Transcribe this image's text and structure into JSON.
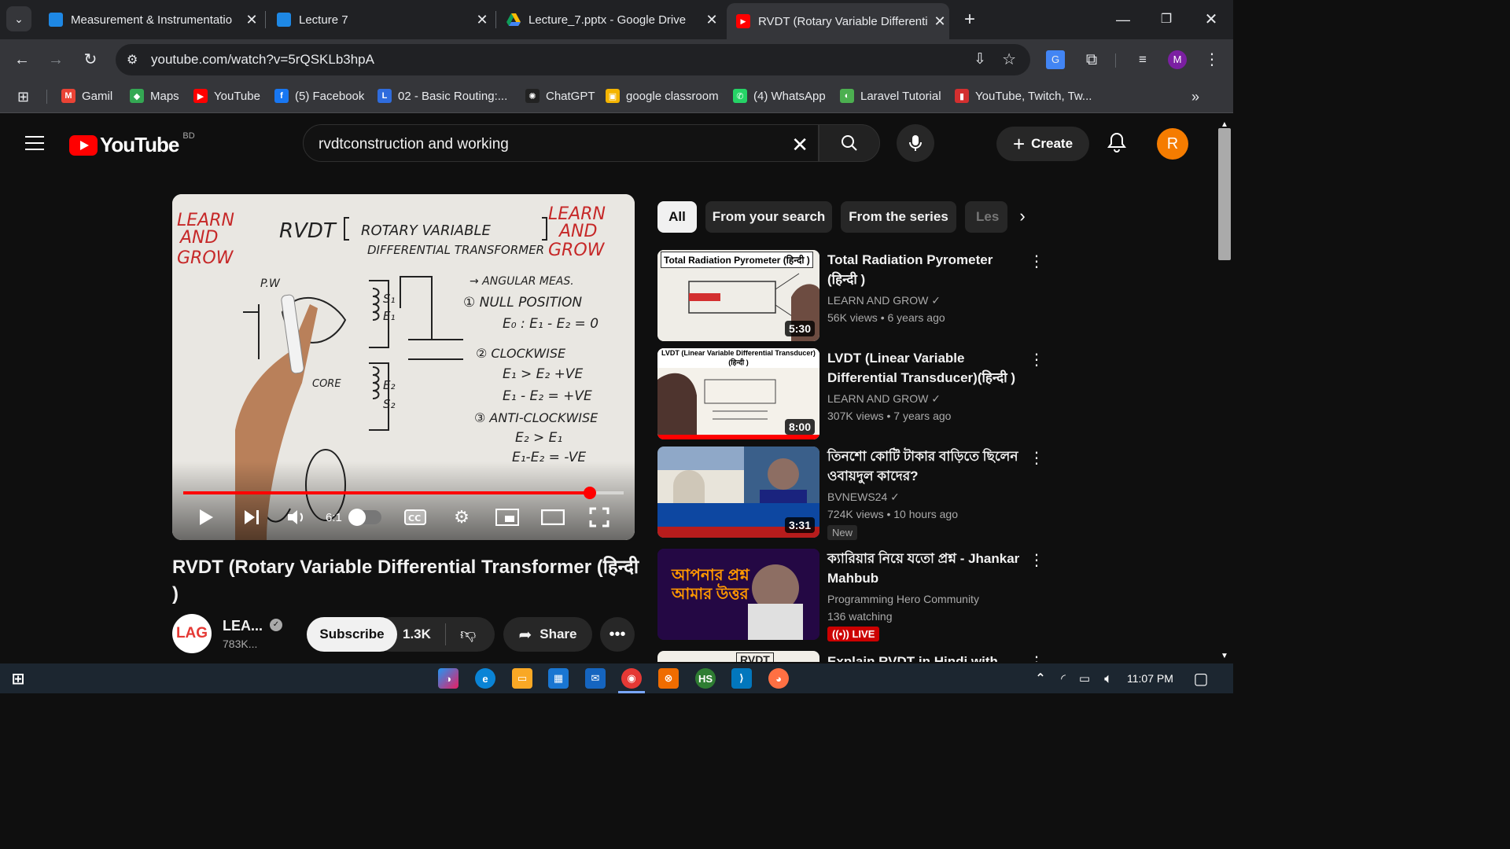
{
  "browser": {
    "tabs": [
      {
        "title": "Measurement & Instrumentatio",
        "icon": "classroom-icon"
      },
      {
        "title": "Lecture 7",
        "icon": "classroom-icon"
      },
      {
        "title": "Lecture_7.pptx - Google Drive",
        "icon": "drive-icon"
      },
      {
        "title": "RVDT (Rotary Variable Differenti",
        "icon": "youtube-icon",
        "active": true
      }
    ],
    "url": "youtube.com/watch?v=5rQSKLb3hpA",
    "profile_initial": "M",
    "bookmarks": [
      {
        "label": "Gamil",
        "icon": "gmail-icon",
        "color": "#ea4335",
        "glyph": "M"
      },
      {
        "label": "Maps",
        "icon": "maps-icon",
        "color": "#34a853",
        "glyph": "◆"
      },
      {
        "label": "YouTube",
        "icon": "youtube-icon",
        "color": "#ff0000",
        "glyph": "▶"
      },
      {
        "label": "(5) Facebook",
        "icon": "facebook-icon",
        "color": "#1877f2",
        "glyph": "f"
      },
      {
        "label": "02 - Basic Routing:...",
        "icon": "laracasts-icon",
        "color": "#2f6cdd",
        "glyph": "L"
      },
      {
        "label": "ChatGPT",
        "icon": "chatgpt-icon",
        "color": "#222222",
        "glyph": "✺"
      },
      {
        "label": "google classroom",
        "icon": "classroom-icon",
        "color": "#f4b400",
        "glyph": "▣"
      },
      {
        "label": "(4) WhatsApp",
        "icon": "whatsapp-icon",
        "color": "#25d366",
        "glyph": "✆"
      },
      {
        "label": "Laravel Tutorial",
        "icon": "laravel-icon",
        "color": "#4caf50",
        "glyph": "◐"
      },
      {
        "label": "YouTube, Twitch, Tw...",
        "icon": "socialblade-icon",
        "color": "#d32f2f",
        "glyph": "▮"
      }
    ]
  },
  "youtube": {
    "country": "BD",
    "logo_text": "YouTube",
    "search_query": "rvdtconstruction and working",
    "create_label": "Create",
    "avatar_initial": "R",
    "player": {
      "time": "6:1",
      "progress": 0.923
    },
    "video_title": "RVDT (Rotary Variable Differential Transformer (हिन्दी )",
    "channel": {
      "name": "LEA...",
      "subs": "783K...",
      "avatar_text": "LAG"
    },
    "subscribe_label": "Subscribe",
    "likes": "1.3K",
    "share_label": "Share",
    "chips": [
      "All",
      "From your search",
      "From the series",
      "Les"
    ],
    "recommendations": [
      {
        "title": "Total Radiation Pyrometer (हिन्दी )",
        "channel": "LEARN AND GROW",
        "verified": true,
        "meta": "56K views  • 6 years ago",
        "duration": "5:30",
        "thumb_text": "Total Radiation Pyrometer (हिन्दी )"
      },
      {
        "title": "LVDT (Linear Variable Differential Transducer)(हिन्दी )",
        "channel": "LEARN AND GROW",
        "verified": true,
        "meta": "307K views  • 7 years ago",
        "duration": "8:00",
        "thumb_text": "LVDT (Linear Variable Differential Transducer)(हिन्दी )"
      },
      {
        "title": "তিনশো কোটি টাকার বাড়িতে ছিলেন ওবায়দুল কাদের?",
        "channel": "BVNEWS24",
        "verified": true,
        "meta": "724K views  • 10 hours ago",
        "duration": "3:31",
        "badge": "New"
      },
      {
        "title": "ক্যারিয়ার নিয়ে যতো প্রশ্ন - Jhankar Mahbub",
        "channel": "Programming Hero Community",
        "verified": false,
        "meta": "136 watching",
        "badge": "LIVE",
        "thumb_text": "আপনার প্রশ্ন আমার উত্তর"
      },
      {
        "title": "Explain RVDT in Hindi with",
        "thumb_text": "RVDT"
      }
    ]
  },
  "taskbar": {
    "time": "11:07 PM"
  }
}
